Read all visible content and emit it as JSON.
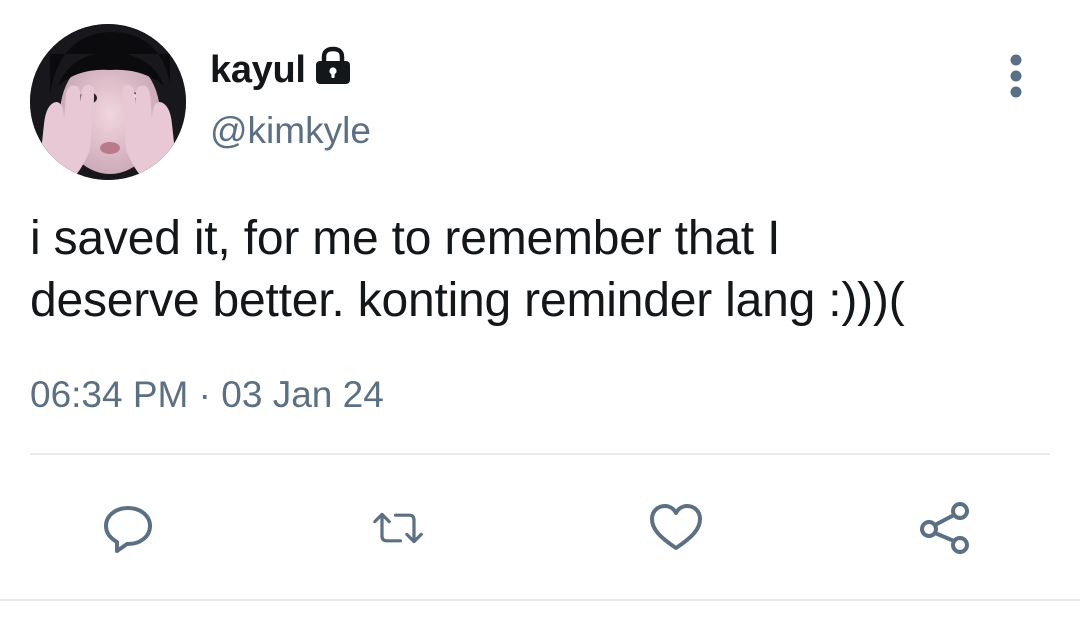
{
  "tweet": {
    "display_name": "kayul",
    "handle": "@kimkyle",
    "text_lines": [
      "i saved it, for me to remember that I",
      "deserve better. konting reminder lang :)))("
    ],
    "time": "06:34 PM",
    "separator": "·",
    "date": "03 Jan 24",
    "account_locked": true
  },
  "actions": {
    "icons": [
      "reply-icon",
      "retweet-icon",
      "like-icon",
      "share-icon"
    ]
  },
  "colors": {
    "text_primary": "#14171a",
    "text_secondary": "#5b7083",
    "icon": "#5b7083",
    "divider": "#e6ecf0",
    "background": "#ffffff"
  }
}
